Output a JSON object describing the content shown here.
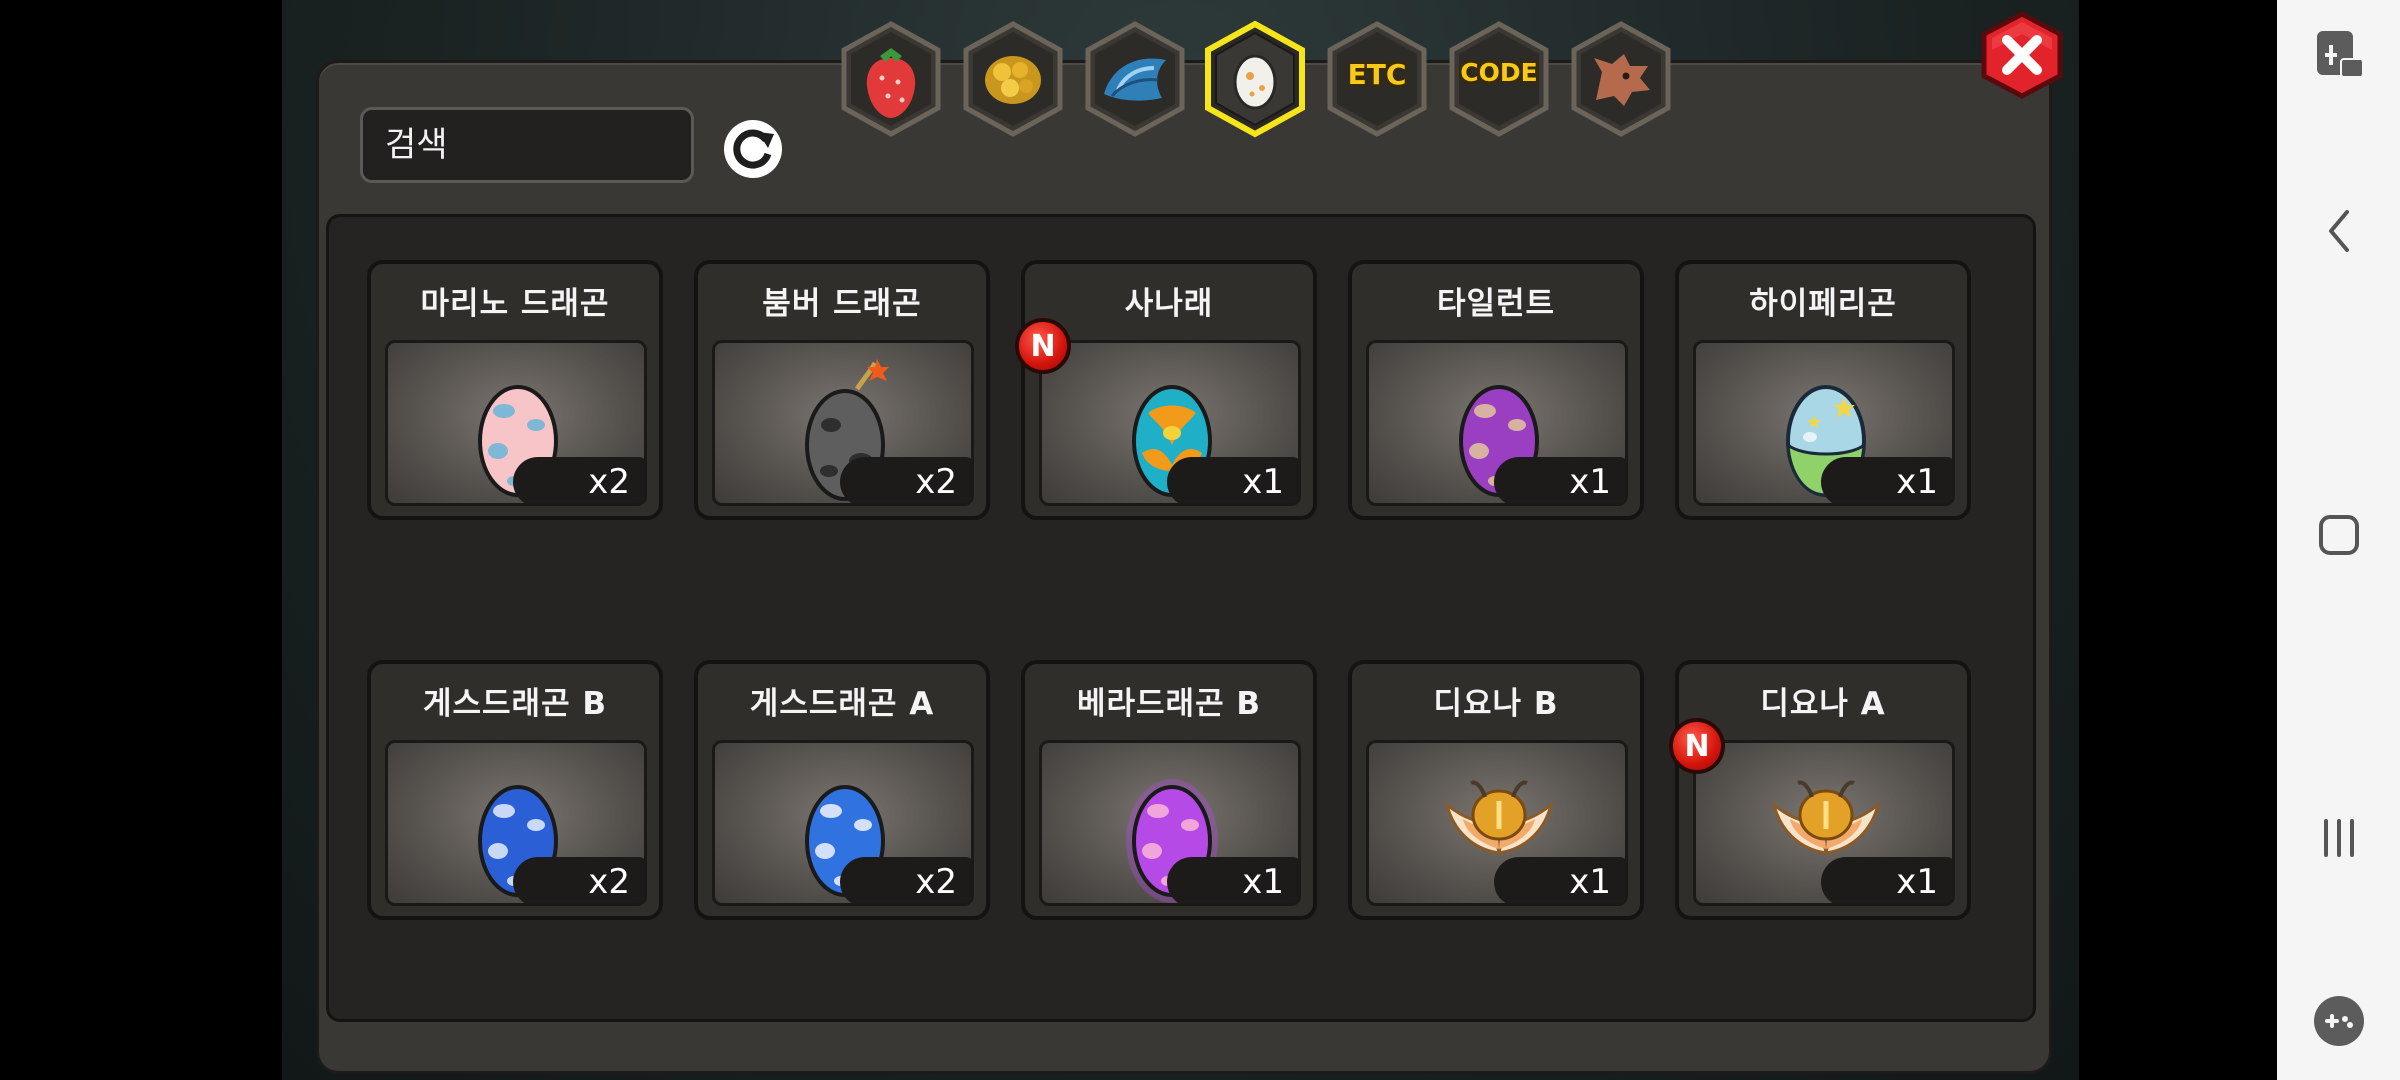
{
  "search": {
    "placeholder": "검색"
  },
  "tabs": [
    {
      "id": "fruit",
      "label": "",
      "icon": "strawberry-icon",
      "selected": false
    },
    {
      "id": "gold",
      "label": "",
      "icon": "gold-ore-icon",
      "selected": false
    },
    {
      "id": "scale",
      "label": "",
      "icon": "blue-scale-icon",
      "selected": false
    },
    {
      "id": "egg",
      "label": "",
      "icon": "egg-icon",
      "selected": true
    },
    {
      "id": "etc",
      "label": "ETC",
      "icon": "",
      "selected": false
    },
    {
      "id": "code",
      "label": "CODE",
      "icon": "",
      "selected": false
    },
    {
      "id": "dragon",
      "label": "",
      "icon": "dragon-head-icon",
      "selected": false
    }
  ],
  "items": [
    {
      "name": "마리노 드래곤",
      "qty": "x2",
      "is_new": false,
      "icon": "pink-spotted-egg-icon",
      "egg_color": "#f7c4c8",
      "spot_color": "#7fb7d6"
    },
    {
      "name": "붐버 드래곤",
      "qty": "x2",
      "is_new": false,
      "icon": "bomb-egg-icon",
      "egg_color": "#5e5e5e",
      "spot_color": "#2e2e2e"
    },
    {
      "name": "사나래",
      "qty": "x1",
      "is_new": true,
      "badge": "N",
      "icon": "orange-teal-egg-icon",
      "egg_color": "#1fb0c8",
      "spot_color": "#f29a1a"
    },
    {
      "name": "타일런트",
      "qty": "x1",
      "is_new": false,
      "icon": "purple-egg-icon",
      "egg_color": "#9a3ec2",
      "spot_color": "#d7b2a0"
    },
    {
      "name": "하이페리곤",
      "qty": "x1",
      "is_new": false,
      "icon": "starry-egg-icon",
      "egg_color": "#a9d7e6",
      "spot_color": "#8fd26a"
    },
    {
      "name": "게스드래곤 B",
      "qty": "x2",
      "is_new": false,
      "icon": "blue-spotted-egg-icon",
      "egg_color": "#2a5fd6",
      "spot_color": "#c9d8f5"
    },
    {
      "name": "게스드래곤 A",
      "qty": "x2",
      "is_new": false,
      "icon": "blue-spotted-egg-icon",
      "egg_color": "#2f72e0",
      "spot_color": "#d3e0f7"
    },
    {
      "name": "베라드래곤 B",
      "qty": "x1",
      "is_new": false,
      "icon": "violet-glow-egg-icon",
      "egg_color": "#b54ae6",
      "spot_color": "#f0a6d8"
    },
    {
      "name": "디요나 B",
      "qty": "x1",
      "is_new": false,
      "icon": "golden-winged-emblem-icon",
      "egg_color": "#e3a227",
      "spot_color": "#f7e4c8"
    },
    {
      "name": "디요나 A",
      "qty": "x1",
      "is_new": true,
      "badge": "N",
      "icon": "golden-winged-emblem-icon",
      "egg_color": "#e3a227",
      "spot_color": "#f7e4c8"
    }
  ],
  "colors": {
    "accent_selected": "#f5e51a",
    "close_red": "#e2232b",
    "new_badge_red": "#d4140c"
  }
}
